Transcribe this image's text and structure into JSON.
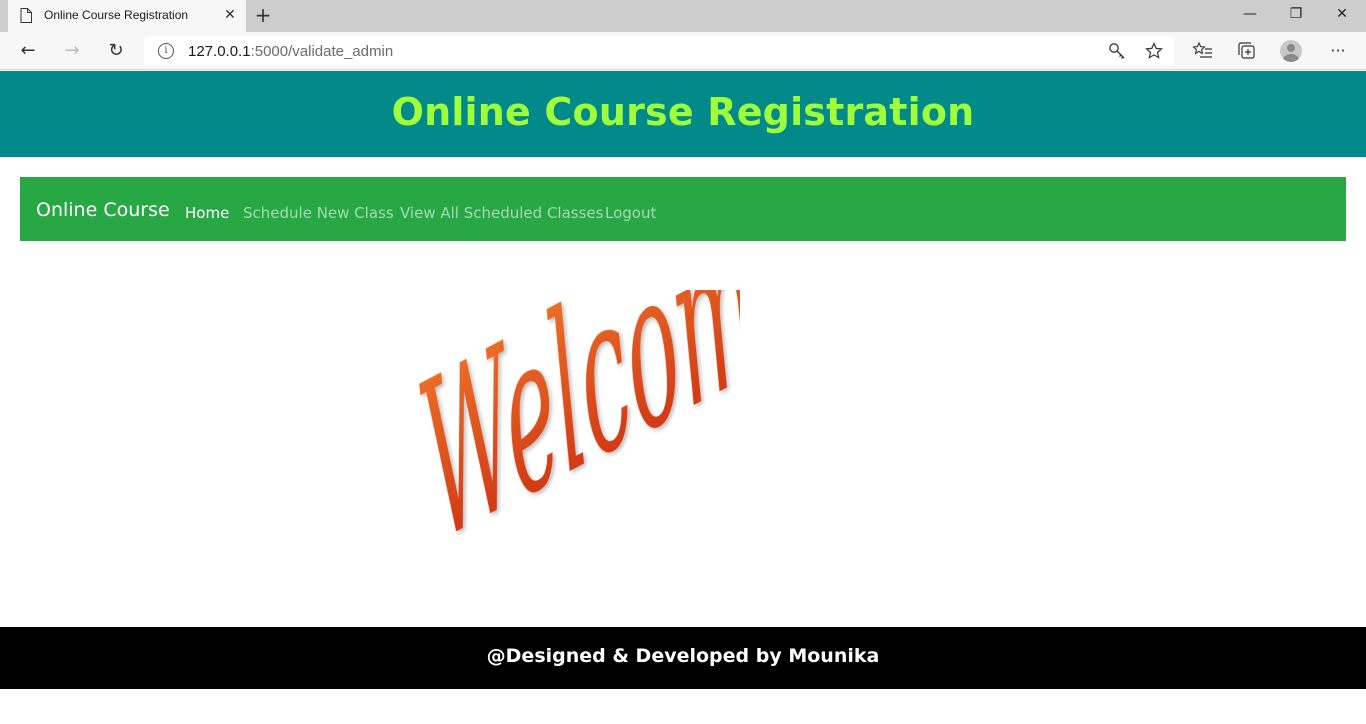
{
  "browser": {
    "tab_title": "Online Course Registration",
    "tab_close": "✕",
    "new_tab": "+",
    "window_controls": {
      "minimize": "—",
      "restore": "❐",
      "close": "✕"
    },
    "back": "←",
    "forward": "→",
    "reload": "↻",
    "url_host": "127.0.0.1",
    "url_rest": ":5000/validate_admin",
    "icons": {
      "info": "info-icon",
      "key": "key-icon",
      "star": "star-icon",
      "favorites": "favorites-icon",
      "collections": "collections-icon",
      "profile": "profile-avatar",
      "more": "more-icon"
    },
    "more_label": "···"
  },
  "header": {
    "title": "Online Course Registration",
    "background": "#028a8a",
    "title_color": "#9eff3a"
  },
  "nav": {
    "brand": "Online Course",
    "background": "#28a745",
    "items": [
      {
        "label": "Home",
        "active": true
      },
      {
        "label": "Schedule New Class",
        "active": false
      },
      {
        "label": "View All Scheduled Classes",
        "active": false
      },
      {
        "label": "Logout",
        "active": false
      }
    ]
  },
  "main": {
    "welcome_image": "Welcome!",
    "welcome_color": "#e0501e"
  },
  "footer": {
    "text": "@Designed & Developed by Mounika"
  }
}
